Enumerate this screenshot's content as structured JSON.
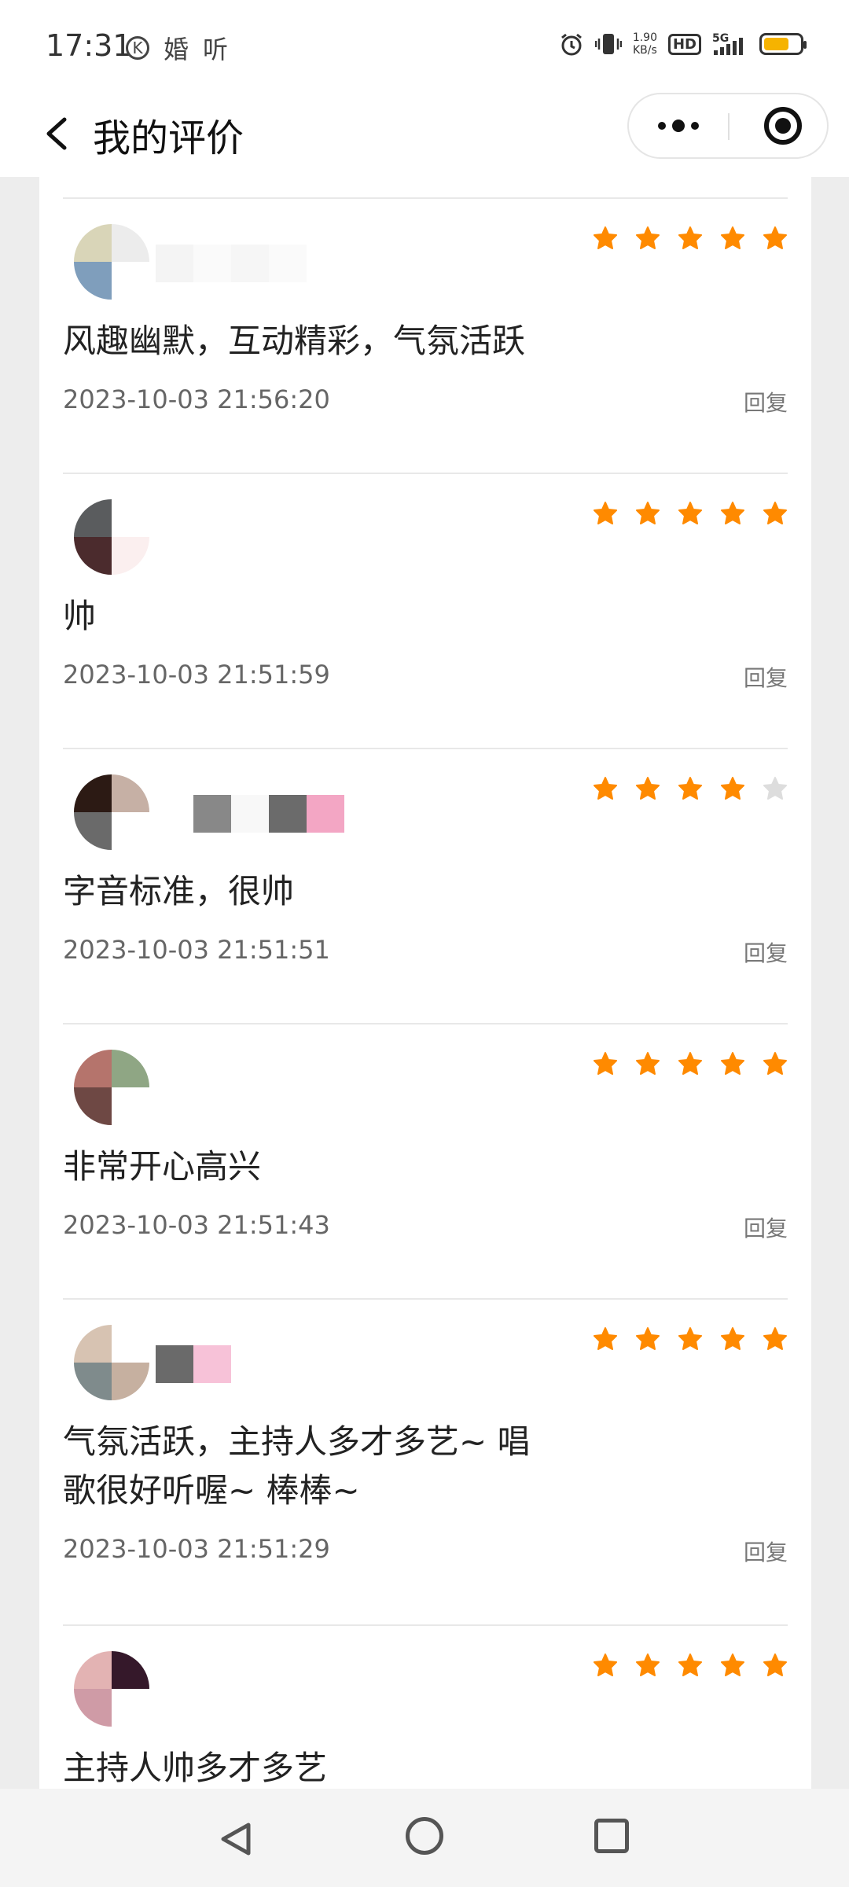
{
  "status_bar": {
    "time": "17:31",
    "k_label": "K",
    "left_icons": [
      "婚",
      "听"
    ],
    "speed_value": "1.90",
    "speed_unit": "KB/s",
    "hd": "HD",
    "network": "5G",
    "battery_level": 0.7,
    "icons": [
      "alarm-icon",
      "vibrate-icon",
      "signal-icon",
      "battery-icon"
    ]
  },
  "nav": {
    "title": "我的评价",
    "back_icon": "chevron-left-icon",
    "more_icon": "more-dots-icon",
    "close_icon": "target-close-icon"
  },
  "colors": {
    "star_on": "#ff8a00",
    "star_off": "#dddddd",
    "page_bg": "#ededed"
  },
  "reviews": [
    {
      "rating": 5,
      "comment": "风趣幽默，互动精彩，气氛活跃",
      "time": "2023-10-03 21:56:20",
      "reply": "回复",
      "avatar": [
        "#d9d5b8",
        "#ececec",
        "#7f9ebc",
        "#ffffff"
      ],
      "name_blocks": [
        "#f4f4f4",
        "#fafafa",
        "#f6f6f6",
        "#fafafa"
      ]
    },
    {
      "rating": 5,
      "comment": "帅",
      "time": "2023-10-03 21:51:59",
      "reply": "回复",
      "avatar": [
        "#5a5c5e",
        "#ffffff",
        "#4b2b2d",
        "#fbefef"
      ],
      "name_blocks": []
    },
    {
      "rating": 4,
      "comment": "字音标准，很帅",
      "time": "2023-10-03 21:51:51",
      "reply": "回复",
      "avatar": [
        "#2c1a14",
        "#c6b0a5",
        "#6a6a6a",
        "#ffffff"
      ],
      "name_blocks": [
        "#ffffff",
        "#888888",
        "#f8f8f8",
        "#6b6b6b",
        "#f3a6c4"
      ]
    },
    {
      "rating": 5,
      "comment": "非常开心高兴",
      "time": "2023-10-03 21:51:43",
      "reply": "回复",
      "avatar": [
        "#b5746c",
        "#8fa684",
        "#6e4844",
        "#ffffff"
      ],
      "name_blocks": []
    },
    {
      "rating": 5,
      "comment": "气氛活跃，主持人多才多艺~ 唱歌很好听喔~ 棒棒~",
      "time": "2023-10-03 21:51:29",
      "reply": "回复",
      "avatar": [
        "#d7c3b2",
        "#ffffff",
        "#7f8b8c",
        "#c6b0a0"
      ],
      "name_blocks": [
        "#6a6a6a",
        "#f7c2d8"
      ]
    },
    {
      "rating": 5,
      "comment": "主持人帅多才多艺",
      "time": "",
      "reply": "",
      "avatar": [
        "#e3b3b3",
        "#35182a",
        "#cf9ba6",
        "#ffffff"
      ],
      "name_blocks": []
    }
  ]
}
